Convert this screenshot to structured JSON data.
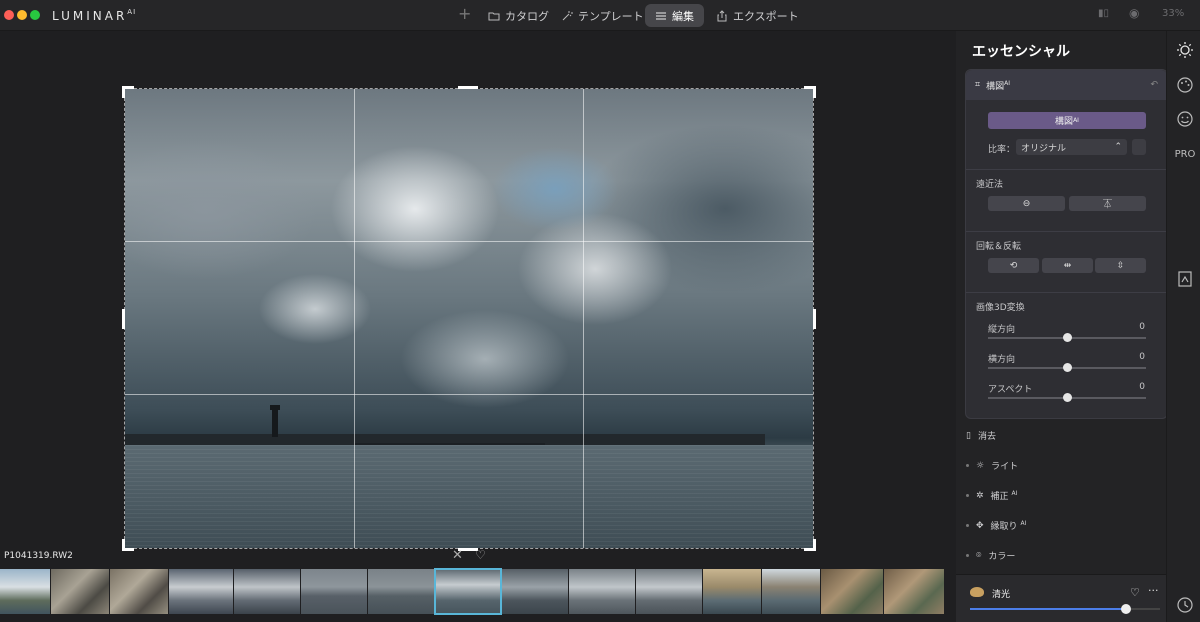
{
  "app": {
    "logo": "LUMINAR",
    "logo_suffix": "AI"
  },
  "nav": {
    "catalog": "カタログ",
    "template": "テンプレート",
    "edit": "編集",
    "export": "エクスポート",
    "zoom": "33%"
  },
  "canvas": {
    "filename": "P1041319.RW2"
  },
  "panel": {
    "title": "エッセンシャル",
    "card_title": "構図",
    "card_title_suffix": "AI",
    "compose_button": "構図",
    "compose_button_suffix": "AI",
    "ratio_label": "比率：",
    "ratio_value": "オリジナル",
    "perspective_label": "遠近法",
    "rotate_label": "回転＆反転",
    "transform_label": "画像3D変換",
    "sliders": [
      {
        "label": "縦方向",
        "value": "0",
        "level": 0.5
      },
      {
        "label": "横方向",
        "value": "0",
        "level": 0.5
      },
      {
        "label": "アスペクト",
        "value": "0",
        "level": 0.5
      }
    ],
    "menu": [
      {
        "label": "消去",
        "suffix": ""
      },
      {
        "label": "ライト",
        "suffix": ""
      },
      {
        "label": "補正",
        "suffix": "AI"
      },
      {
        "label": "縁取り",
        "suffix": "AI"
      },
      {
        "label": "カラー",
        "suffix": ""
      }
    ],
    "bottom_title": "清光",
    "bottom_level": 0.82
  },
  "tools": {
    "pro_label": "PRO"
  },
  "colors": {
    "accent_purple": "#6a5a88",
    "selection_blue": "#59b6d8",
    "slider_blue": "#4c7ee8"
  }
}
